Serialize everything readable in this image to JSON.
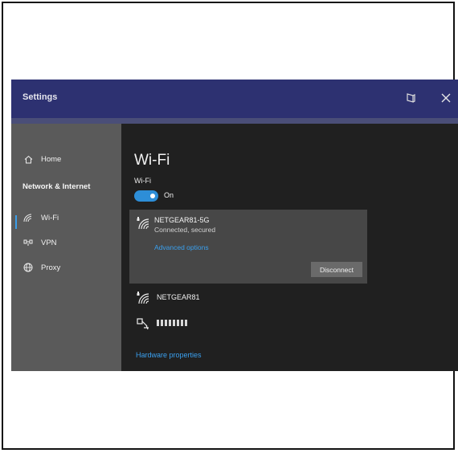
{
  "window": {
    "title": "Settings"
  },
  "sidebar": {
    "home": "Home",
    "section": "Network & Internet",
    "items": [
      {
        "label": "Wi-Fi",
        "icon": "wifi-icon",
        "selected": true
      },
      {
        "label": "VPN",
        "icon": "vpn-icon",
        "selected": false
      },
      {
        "label": "Proxy",
        "icon": "globe-icon",
        "selected": false
      }
    ]
  },
  "main": {
    "heading": "Wi-Fi",
    "wifi_label": "Wi-Fi",
    "toggle_state": "On",
    "connected": {
      "name": "NETGEAR81-5G",
      "status": "Connected, secured",
      "advanced": "Advanced options",
      "disconnect": "Disconnect"
    },
    "networks": [
      {
        "name": "NETGEAR81"
      },
      {
        "name": ""
      }
    ],
    "hardware_link": "Hardware properties"
  },
  "colors": {
    "accent": "#2d8ed8",
    "titlebar": "#2d3171",
    "link": "#3aa0ef"
  }
}
